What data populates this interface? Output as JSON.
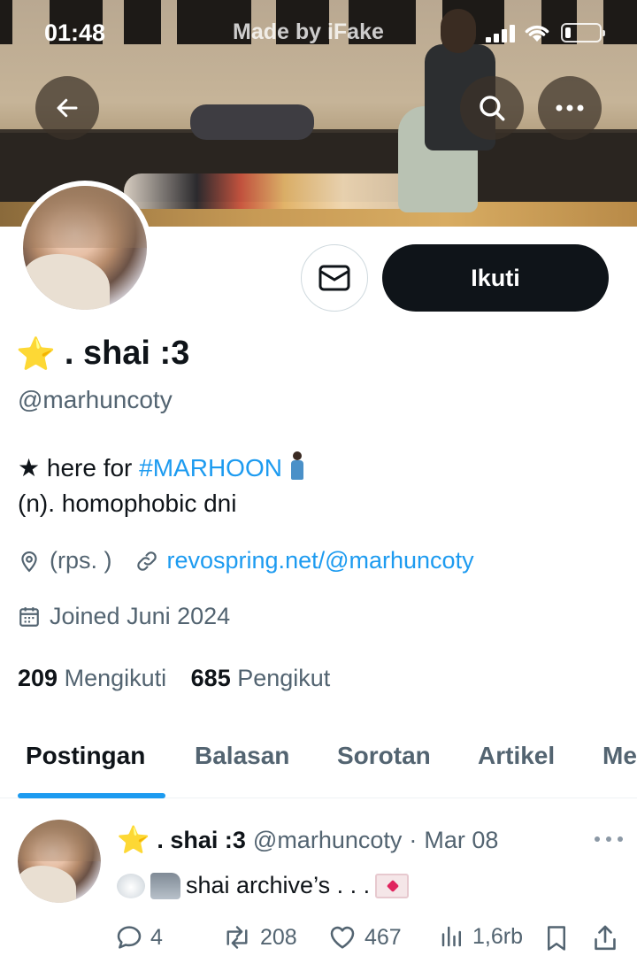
{
  "status_bar": {
    "time": "01:48",
    "watermark": "Made by iFake"
  },
  "banner": {
    "back_icon": "arrow-left-icon",
    "search_icon": "search-icon",
    "more_icon": "more-horizontal-icon"
  },
  "profile": {
    "display_name": ". shai :3",
    "star_emoji": "⭐",
    "handle": "@marhuncoty",
    "message_icon": "mail-icon",
    "follow_label": "Ikuti",
    "bio_line1_prefix": "★ here for ",
    "bio_hashtag": "#MARHOON",
    "bio_line2": "(n). homophobic dni",
    "location": "(rps. )",
    "website": "revospring.net/@marhuncoty",
    "joined": "Joined Juni 2024",
    "following_count": "209",
    "following_label": "Mengikuti",
    "followers_count": "685",
    "followers_label": "Pengikut"
  },
  "tabs": [
    {
      "label": "Postingan",
      "active": true
    },
    {
      "label": "Balasan",
      "active": false
    },
    {
      "label": "Sorotan",
      "active": false
    },
    {
      "label": "Artikel",
      "active": false
    },
    {
      "label": "Me",
      "active": false
    }
  ],
  "post": {
    "author_name": ". shai :3",
    "author_handle": "@marhuncoty",
    "separator": "·",
    "date": "Mar 08",
    "text": "shai archive’s . . .",
    "replies": "4",
    "reposts": "208",
    "likes": "467",
    "views": "1,6rb"
  },
  "colors": {
    "accent": "#1d9bf0",
    "text_primary": "#0f1419",
    "text_secondary": "#536471",
    "follow_button_bg": "#0f1419"
  }
}
